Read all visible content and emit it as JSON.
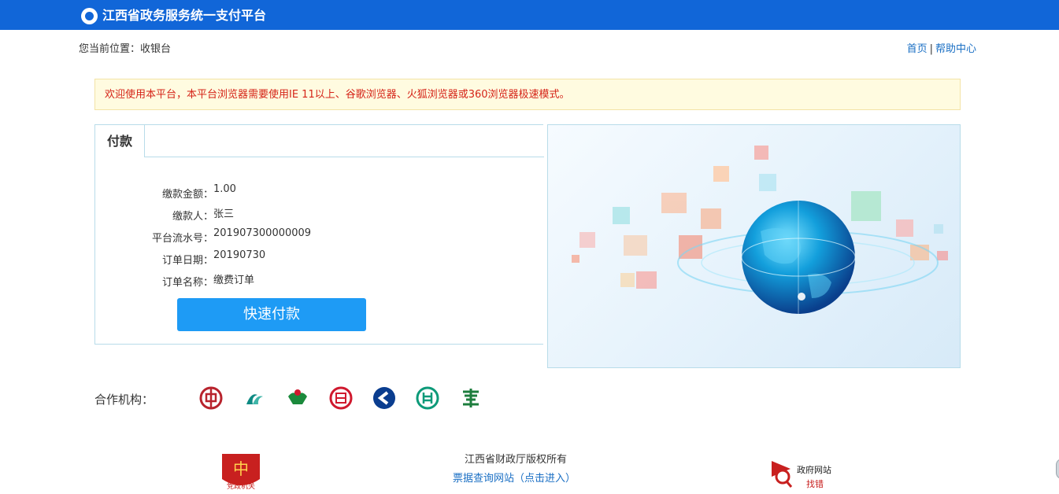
{
  "header": {
    "title": "江西省政务服务统一支付平台"
  },
  "location": {
    "text": "您当前位置：收银台"
  },
  "top_links": {
    "home": "首页",
    "separator": "|",
    "help": "帮助中心"
  },
  "notice": {
    "text": "欢迎使用本平台，本平台浏览器需要使用IE 11以上、谷歌浏览器、火狐浏览器或360浏览器极速模式。"
  },
  "payment": {
    "tab_label": "付款",
    "fields": [
      {
        "label": "缴款金额：",
        "value": "1.00"
      },
      {
        "label": "缴款人：",
        "value": "张三"
      },
      {
        "label": "平台流水号：",
        "value": "201907300000009"
      },
      {
        "label": "订单日期：",
        "value": "20190730"
      },
      {
        "label": "订单名称：",
        "value": "缴费订单"
      }
    ],
    "pay_button": "快速付款"
  },
  "partners": {
    "label": "合作机构：",
    "banks": [
      {
        "name": "bank-of-china-icon",
        "color": "#b8232d"
      },
      {
        "name": "bank-icon-2",
        "color": "#0e8a83"
      },
      {
        "name": "bank-icon-3",
        "color": "#1b8a3c"
      },
      {
        "name": "bank-icon-4",
        "color": "#d0192e"
      },
      {
        "name": "bank-icon-5",
        "color": "#0a3d8f"
      },
      {
        "name": "bank-icon-6",
        "color": "#0d9a79"
      },
      {
        "name": "bank-icon-7",
        "color": "#1d7d3d"
      }
    ]
  },
  "footer": {
    "copyright": "江西省财政厅版权所有",
    "link": "票据查询网站（点击进入）",
    "badge_right_line1": "政府网站",
    "badge_right_line2": "找错",
    "badge_left_caption": "党政机关"
  },
  "colors": {
    "header_blue": "#1166d8",
    "button_blue": "#1e9bf5",
    "notice_red": "#d52418",
    "link_blue": "#1a6fc4"
  }
}
